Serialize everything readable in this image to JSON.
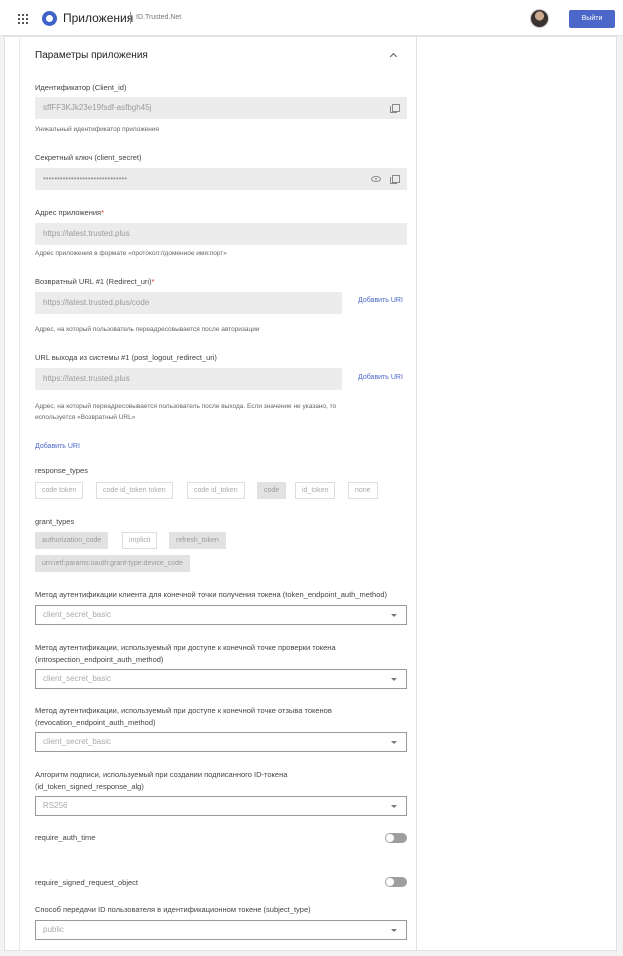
{
  "header": {
    "app_title": "Приложения",
    "brand": "ID.Trusted.Net",
    "logout_label": "Выйти",
    "icons": [
      "apps-grid-icon",
      "logo-icon",
      "avatar"
    ],
    "colors": {
      "accent": "#4a67c9"
    }
  },
  "section": {
    "title": "Параметры приложения"
  },
  "client_id": {
    "label": "Идентификатор (Client_id)",
    "value": "sffFF3KJk23e19fsdf-asfbgh45j",
    "hint": "Уникальный идентификатор приложения"
  },
  "client_secret": {
    "label": "Секретный ключ (client_secret)",
    "value": "••••••••••••••••••••••••••••••"
  },
  "app_url": {
    "label": "Адрес приложения",
    "required_mark": "*",
    "value": "https://latest.trusted.plus",
    "hint": "Адрес приложения в формате «протокол://доменное имя:порт»"
  },
  "redirect_uri": {
    "label": "Возвратный URL #1 (Redirect_uri)",
    "required_mark": "*",
    "value": "https://latest.trusted.plus/code",
    "add_link": "Добавить URI",
    "hint": "Адрес, на который пользователь переадресовывается после авторизации"
  },
  "logout_uri": {
    "label": "URL выхода из системы #1 (post_logout_redirect_uri)",
    "value": "https://latest.trusted.plus",
    "add_link": "Добавить URI",
    "hint": "Адрес, на который переадресовывается пользователь после выхода. Если значение не указано, то используется «Возвратный URL»"
  },
  "add_uri_link": "Добавить URI",
  "response_types": {
    "label": "response_types",
    "options": [
      {
        "label": "code token",
        "selected": false
      },
      {
        "label": "code id_token token",
        "selected": false
      },
      {
        "label": "code id_token",
        "selected": false
      },
      {
        "label": "code",
        "selected": true
      },
      {
        "label": "id_token",
        "selected": false
      },
      {
        "label": "none",
        "selected": false
      }
    ]
  },
  "grant_types": {
    "label": "grant_types",
    "options": [
      {
        "label": "authorization_code",
        "selected": true
      },
      {
        "label": "implicit",
        "selected": false
      },
      {
        "label": "refresh_token",
        "selected": true
      },
      {
        "label": "urn:ietf:params:oauth:grant-type:device_code",
        "selected": true
      }
    ]
  },
  "token_auth_method": {
    "label": "Метод аутентификации клиента для конечной точки получения токена (token_endpoint_auth_method)",
    "value": "client_secret_basic"
  },
  "introspection_auth_method": {
    "label_line1": "Метод аутентификации, используемый при доступе к конечной точке проверки токена",
    "label_line2": "(introspection_endpoint_auth_method)",
    "value": "client_secret_basic"
  },
  "revocation_auth_method": {
    "label_line1": "Метод аутентификации, используемый при доступе к конечной точке отзыва токенов",
    "label_line2": "(revocation_endpoint_auth_method)",
    "value": "client_secret_basic"
  },
  "id_token_alg": {
    "label_line1": "Алгоритм подписи, используемый при создании подписанного ID-токена",
    "label_line2": "(id_token_signed_response_alg)",
    "value": "RS256"
  },
  "require_auth_time": {
    "label": "require_auth_time",
    "enabled": false
  },
  "require_signed_request_object": {
    "label": "require_signed_request_object",
    "enabled": false
  },
  "subject_type": {
    "label": "Способ передачи ID пользователя в идентификационном токене (subject_type)",
    "value": "public"
  }
}
